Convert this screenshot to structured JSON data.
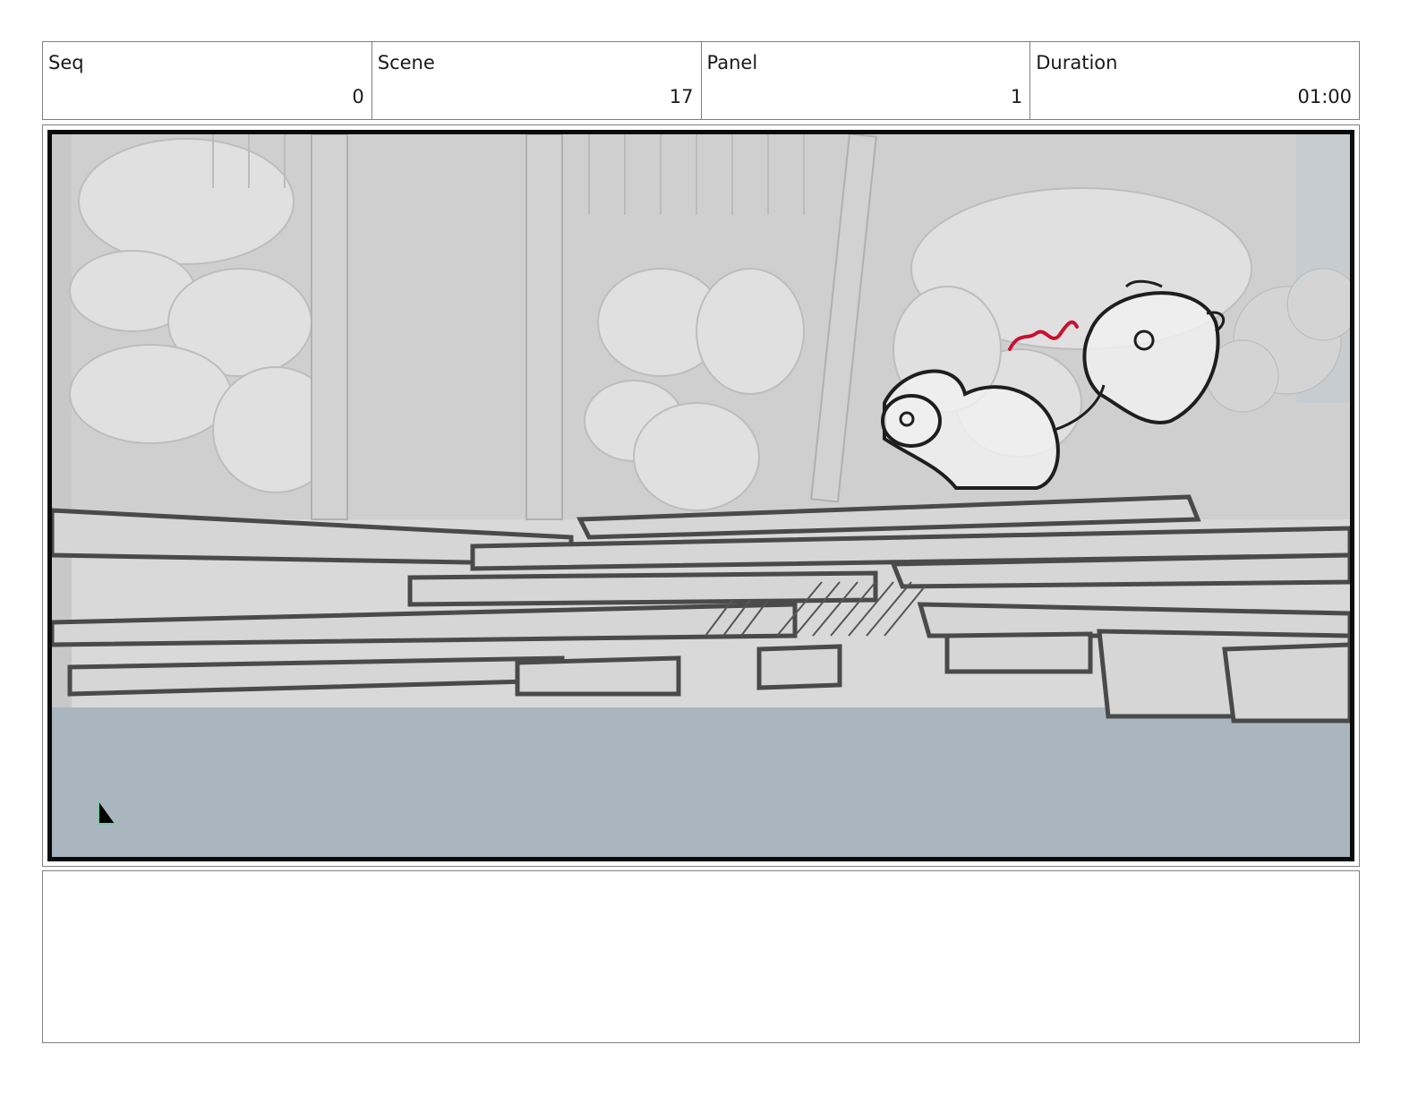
{
  "header": {
    "seq_label": "Seq",
    "seq_value": "0",
    "scene_label": "Scene",
    "scene_value": "17",
    "panel_label": "Panel",
    "panel_value": "1",
    "duration_label": "Duration",
    "duration_value": "01:00"
  },
  "panel": {
    "image": "storyboard-sketch"
  },
  "notes": {
    "text": ""
  }
}
